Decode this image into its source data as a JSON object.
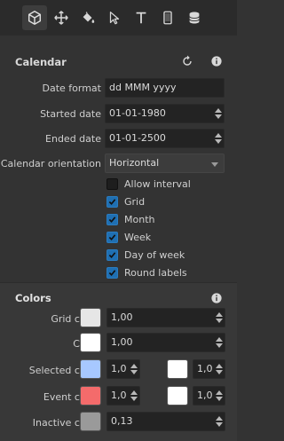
{
  "toolbar": {
    "tools": [
      {
        "icon": "cube-icon",
        "active": true
      },
      {
        "icon": "move-icon",
        "active": false
      },
      {
        "icon": "paint-bucket-icon",
        "active": false
      },
      {
        "icon": "cursor-icon",
        "active": false
      },
      {
        "icon": "text-icon",
        "active": false
      },
      {
        "icon": "phone-icon",
        "active": false
      },
      {
        "icon": "database-icon",
        "active": false
      }
    ]
  },
  "calendar": {
    "title": "Calendar",
    "date_format_label": "Date format",
    "date_format_value": "dd MMM yyyy",
    "started_label": "Started date",
    "started_value": "01-01-1980",
    "ended_label": "Ended date",
    "ended_value": "01-01-2500",
    "orientation_label": "Calendar orientation",
    "orientation_value": "Horizontal",
    "checkboxes": [
      {
        "label": "Allow interval",
        "checked": false
      },
      {
        "label": "Grid",
        "checked": true
      },
      {
        "label": "Month",
        "checked": true
      },
      {
        "label": "Week",
        "checked": true
      },
      {
        "label": "Day of week",
        "checked": true
      },
      {
        "label": "Round labels",
        "checked": true
      }
    ]
  },
  "colors": {
    "title": "Colors",
    "grid": {
      "label": "Grid color",
      "color": "#e6e6e6",
      "value": "1,00"
    },
    "color": {
      "label": "Color",
      "color": "#ffffff",
      "value": "1,00"
    },
    "selected": {
      "label": "Selected color",
      "color": "#a7c8ff",
      "value": "1,0",
      "color2": "#ffffff",
      "value2": "1,0"
    },
    "event": {
      "label": "Event color",
      "color": "#f46b6b",
      "value": "1,0",
      "color2": "#ffffff",
      "value2": "1,0"
    },
    "inactive": {
      "label": "Inactive color",
      "color": "#9a9a9a",
      "value": "0,13"
    }
  }
}
